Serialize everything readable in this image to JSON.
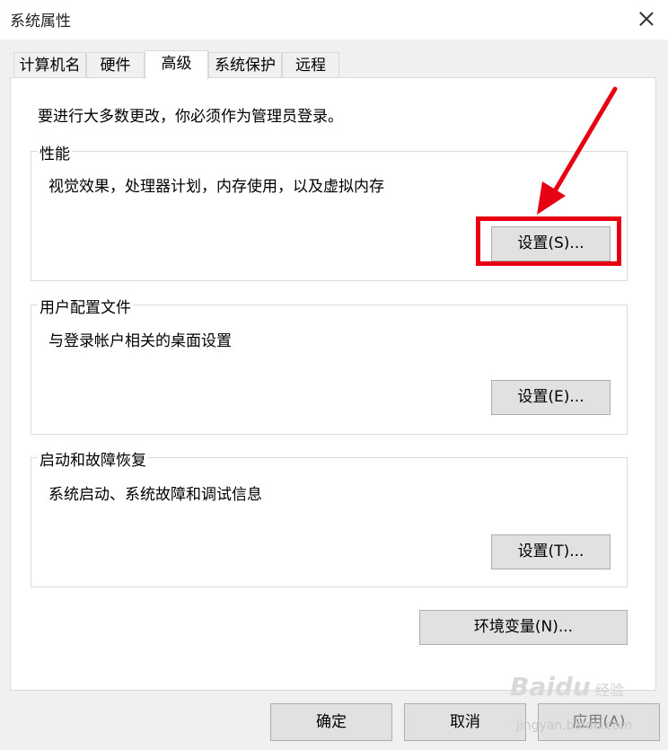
{
  "window": {
    "title": "系统属性"
  },
  "tabs": [
    {
      "label": "计算机名"
    },
    {
      "label": "硬件"
    },
    {
      "label": "高级"
    },
    {
      "label": "系统保护"
    },
    {
      "label": "远程"
    }
  ],
  "advanced": {
    "intro": "要进行大多数更改，你必须作为管理员登录。",
    "performance": {
      "label": "性能",
      "description": "视觉效果，处理器计划，内存使用，以及虚拟内存",
      "button": "设置(S)..."
    },
    "user_profiles": {
      "label": "用户配置文件",
      "description": "与登录帐户相关的桌面设置",
      "button": "设置(E)..."
    },
    "startup_recovery": {
      "label": "启动和故障恢复",
      "description": "系统启动、系统故障和调试信息",
      "button": "设置(T)..."
    },
    "env_button": "环境变量(N)..."
  },
  "footer": {
    "ok": "确定",
    "cancel": "取消",
    "apply": "应用(A)"
  },
  "watermark": {
    "logo": "Baidu",
    "text": "经验",
    "url": "jingyan.baidu.com"
  },
  "colors": {
    "highlight": "#e60012",
    "arrow": "#e60012"
  }
}
